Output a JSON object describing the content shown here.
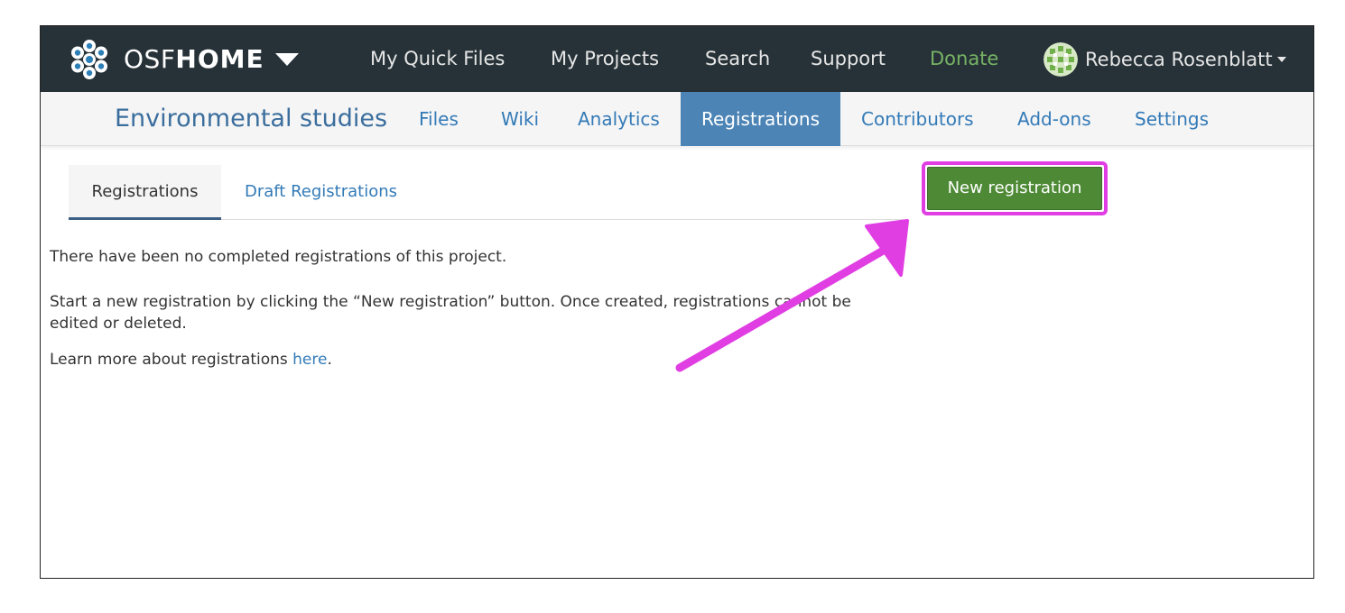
{
  "topnav": {
    "brand_light": "OSF",
    "brand_bold": "HOME",
    "links": [
      {
        "label": "My Quick Files"
      },
      {
        "label": "My Projects"
      },
      {
        "label": "Search"
      },
      {
        "label": "Support"
      },
      {
        "label": "Donate"
      }
    ],
    "user_name": "Rebecca Rosenblatt",
    "donate_color": "#77b364"
  },
  "project": {
    "title": "Environmental studies",
    "tabs": [
      {
        "label": "Files"
      },
      {
        "label": "Wiki"
      },
      {
        "label": "Analytics"
      },
      {
        "label": "Registrations",
        "active": true
      },
      {
        "label": "Contributors"
      },
      {
        "label": "Add-ons"
      },
      {
        "label": "Settings"
      }
    ]
  },
  "registrations": {
    "tabs": [
      {
        "label": "Registrations",
        "active": true
      },
      {
        "label": "Draft Registrations"
      }
    ],
    "new_button": "New registration",
    "message_1": "There have been no completed registrations of this project.",
    "message_2": "Start a new registration by clicking the “New registration” button. Once created, registrations cannot be edited or deleted.",
    "message_3_prefix": "Learn more about registrations ",
    "message_3_link": "here",
    "message_3_suffix": "."
  },
  "colors": {
    "topbar": "#263238",
    "active_tab": "#4c84b6",
    "button_green": "#4e8a35",
    "highlight": "#e03ee3"
  },
  "icons": [
    "osf-logo-icon",
    "caret-down-icon",
    "avatar",
    "arrow-annotation"
  ]
}
